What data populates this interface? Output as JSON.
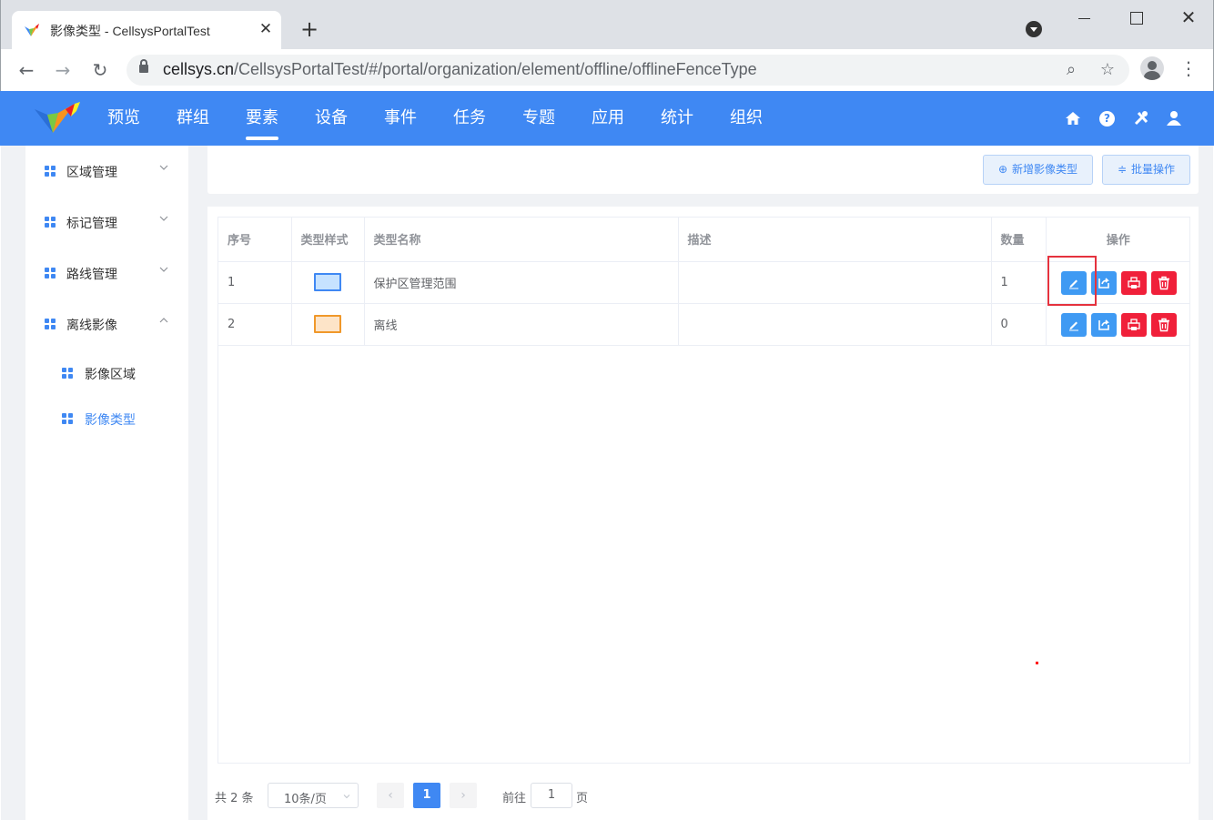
{
  "browser": {
    "tab_title": "影像类型 - CellsysPortalTest",
    "url_host": "cellsys.cn",
    "url_path": "/CellsysPortalTest/#/portal/organization/element/offline/offlineFenceType"
  },
  "header": {
    "menu": [
      "预览",
      "群组",
      "要素",
      "设备",
      "事件",
      "任务",
      "专题",
      "应用",
      "统计",
      "组织"
    ],
    "active_menu": "要素",
    "icons": [
      "home-icon",
      "help-icon",
      "tools-icon",
      "user-icon"
    ]
  },
  "sidebar": {
    "items": [
      {
        "label": "区域管理",
        "expanded": false
      },
      {
        "label": "标记管理",
        "expanded": false
      },
      {
        "label": "路线管理",
        "expanded": false
      },
      {
        "label": "离线影像",
        "expanded": true
      }
    ],
    "subitems": [
      {
        "label": "影像区域",
        "active": false
      },
      {
        "label": "影像类型",
        "active": true
      }
    ]
  },
  "toolbar": {
    "add_label": "新增影像类型",
    "batch_label": "批量操作"
  },
  "table": {
    "columns": [
      "序号",
      "类型样式",
      "类型名称",
      "描述",
      "数量",
      "操作"
    ],
    "rows": [
      {
        "index": "1",
        "style_border": "#3f88f3",
        "style_fill": "#c6e2ff",
        "name": "保护区管理范围",
        "desc": "",
        "count": "1"
      },
      {
        "index": "2",
        "style_border": "#f0982a",
        "style_fill": "#fde4c8",
        "name": "离线",
        "desc": "",
        "count": "0"
      }
    ],
    "row_actions": [
      "edit-icon",
      "export-icon",
      "print-icon",
      "delete-icon"
    ]
  },
  "pagination": {
    "total": "共 2 条",
    "page_size": "10条/页",
    "current_page": "1",
    "goto_label": "前往",
    "goto_value": "1",
    "goto_unit": "页"
  },
  "colors": {
    "brand": "#3f88f3",
    "danger": "#f0203a"
  }
}
